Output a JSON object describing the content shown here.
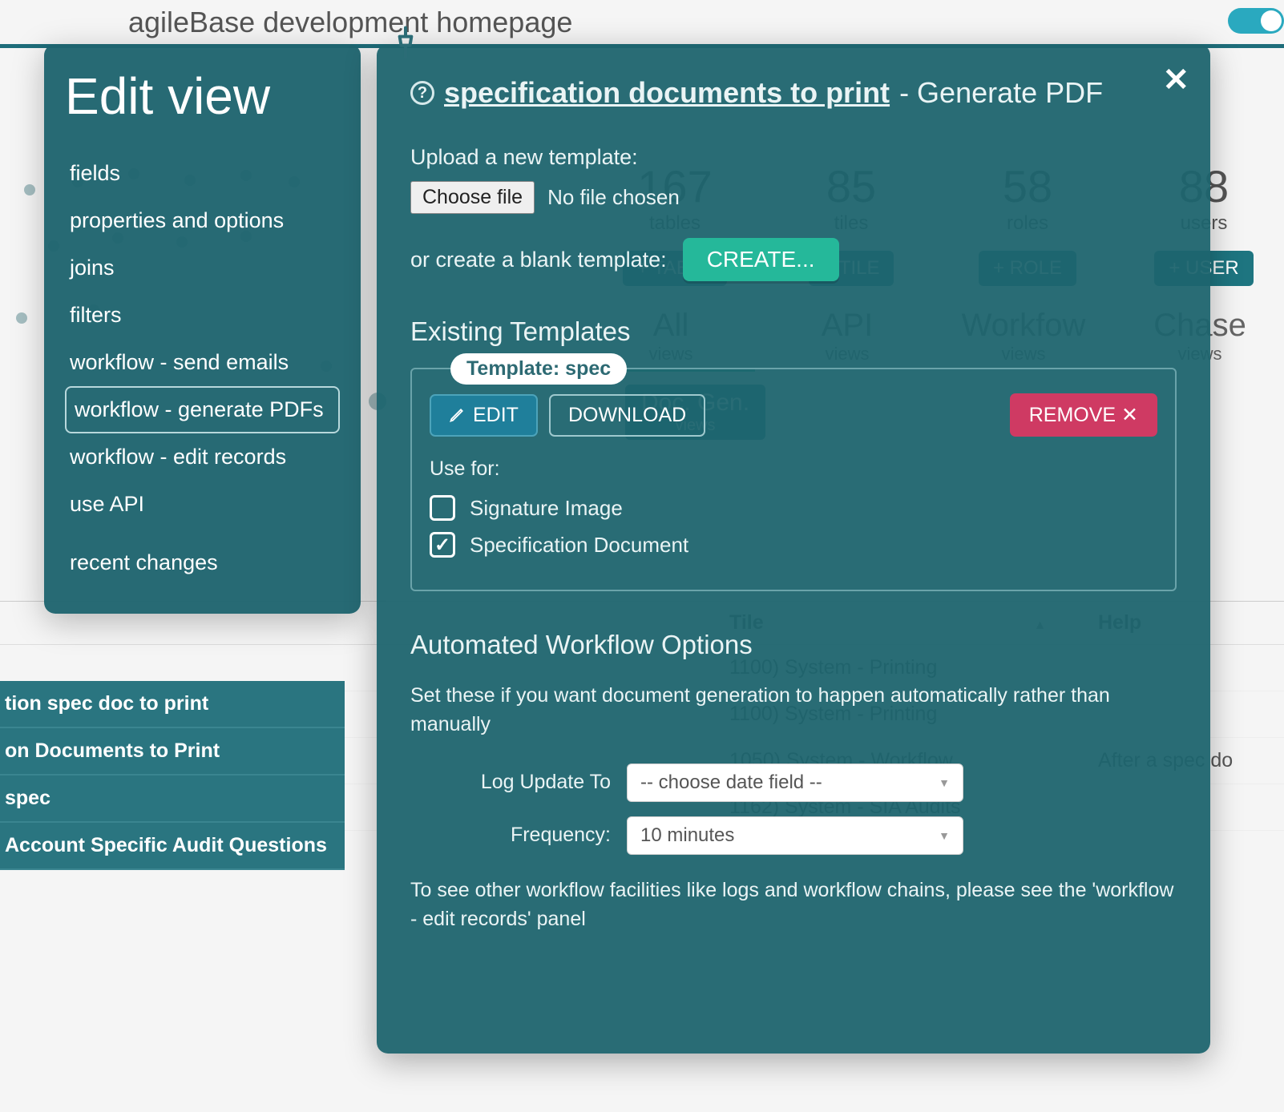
{
  "bg": {
    "title": "agileBase development homepage",
    "stats": [
      {
        "num": "167",
        "lbl": "tables",
        "btn": "+ TABLE"
      },
      {
        "num": "85",
        "lbl": "tiles",
        "btn": "+ TILE"
      },
      {
        "num": "58",
        "lbl": "roles",
        "btn": "+ ROLE"
      },
      {
        "num": "88",
        "lbl": "users",
        "btn": "+ USER"
      }
    ],
    "tabs": [
      {
        "t": "All",
        "s": "views",
        "active": true
      },
      {
        "t": "API",
        "s": "views"
      },
      {
        "t": "Workfow",
        "s": "views"
      },
      {
        "t": "Chase",
        "s": "views"
      }
    ],
    "docgen": {
      "t": "Doc. Gen.",
      "s": "views"
    },
    "table": {
      "headers": {
        "tile": "Tile",
        "help": "Help"
      },
      "sort_icon": "▲",
      "rows": [
        {
          "name": "tion spec doc to print",
          "tile": "1100) System - Printing",
          "help": ""
        },
        {
          "name": "on Documents to Print",
          "tile": "1100) System - Printing",
          "help": ""
        },
        {
          "name": "spec",
          "tile": "1050) System - Workflow",
          "help": "After a spec do"
        },
        {
          "name": "Account Specific Audit Questions",
          "tile": "1162) System - SIA Audits",
          "help": ""
        }
      ]
    }
  },
  "sidebar": {
    "title": "Edit view",
    "items": [
      "fields",
      "properties and options",
      "joins",
      "filters",
      "workflow - send emails",
      "workflow - generate PDFs",
      "workflow - edit records",
      "use API",
      "recent changes"
    ],
    "active_index": 5
  },
  "modal": {
    "title_link": "specification documents to print",
    "title_suffix": " - Generate PDF",
    "upload_label": "Upload a new template:",
    "choose_file_btn": "Choose file",
    "no_file": "No file chosen",
    "create_label": "or create a blank template:",
    "create_btn": "CREATE...",
    "existing_heading": "Existing Templates",
    "template": {
      "tag": "Template: spec",
      "edit": "EDIT",
      "download": "DOWNLOAD",
      "remove": "REMOVE ✕",
      "use_for": "Use for:",
      "checks": [
        {
          "label": "Signature Image",
          "checked": false
        },
        {
          "label": "Specification Document",
          "checked": true
        }
      ]
    },
    "auto_heading": "Automated Workflow Options",
    "auto_desc": "Set these if you want document generation to happen automatically rather than manually",
    "log_label": "Log Update To",
    "log_value": "-- choose date field --",
    "freq_label": "Frequency:",
    "freq_value": "10 minutes",
    "footnote": "To see other workflow facilities like logs and workflow chains, please see the 'workflow - edit records' panel"
  }
}
